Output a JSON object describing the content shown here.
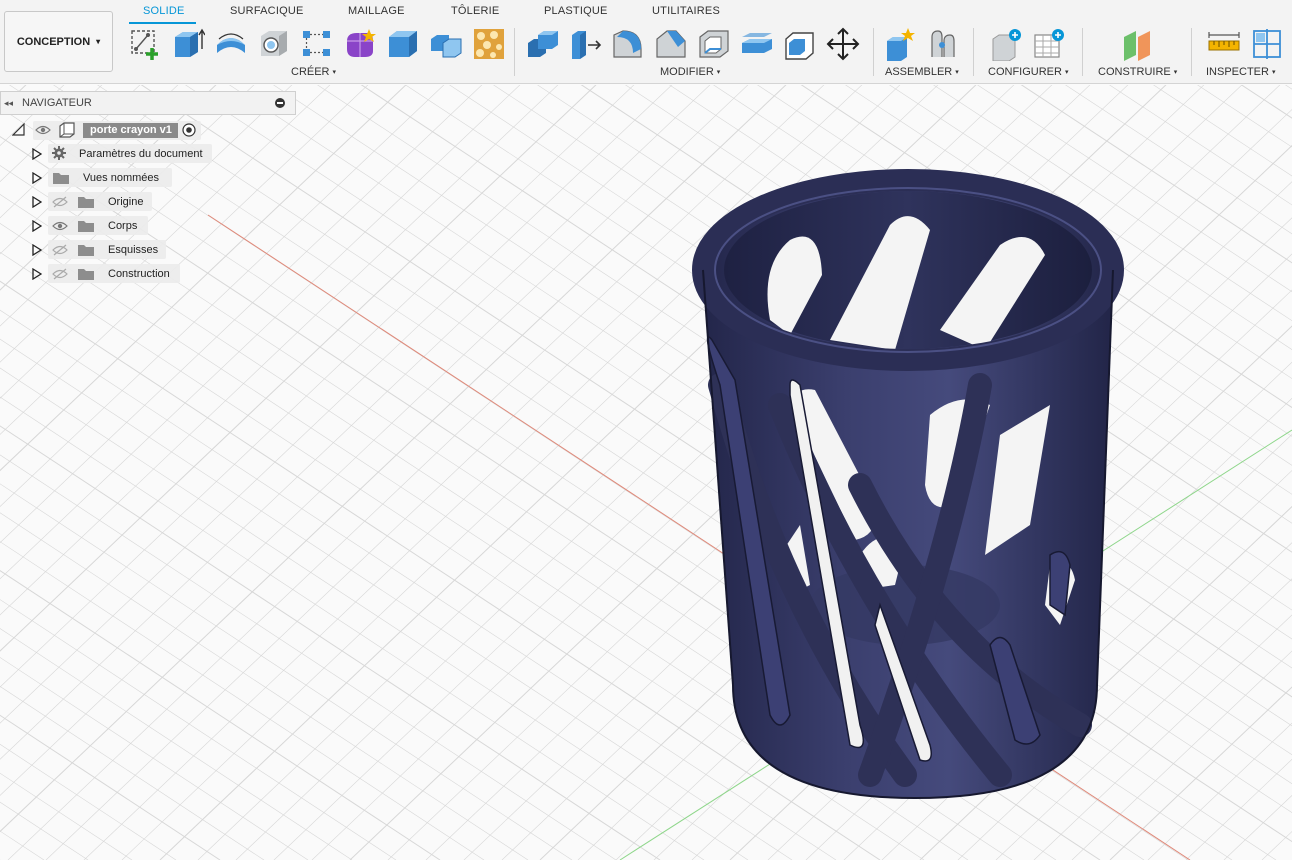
{
  "workspace": {
    "label": "CONCEPTION",
    "caret": "▾"
  },
  "tabs": [
    {
      "label": "SOLIDE",
      "active": true
    },
    {
      "label": "SURFACIQUE"
    },
    {
      "label": "MAILLAGE"
    },
    {
      "label": "TÔLERIE"
    },
    {
      "label": "PLASTIQUE"
    },
    {
      "label": "UTILITAIRES"
    }
  ],
  "groups": {
    "create": {
      "label": "CRÉER",
      "caret": "▾"
    },
    "modify": {
      "label": "MODIFIER",
      "caret": "▾"
    },
    "assemble": {
      "label": "ASSEMBLER",
      "caret": "▾"
    },
    "configure": {
      "label": "CONFIGURER",
      "caret": "▾"
    },
    "construct": {
      "label": "CONSTRUIRE",
      "caret": "▾"
    },
    "inspect": {
      "label": "INSPECTER",
      "caret": "▾"
    }
  },
  "tools": {
    "create": [
      "create-sketch-icon",
      "extrude-icon",
      "revolve-icon",
      "hole-icon",
      "pattern-icon",
      "form-icon",
      "box-icon",
      "combine-icon",
      "lattice-icon"
    ],
    "modify": [
      "press-pull-icon",
      "move-face-icon",
      "fillet-icon",
      "chamfer-icon",
      "shell-icon",
      "draft-icon",
      "scale-icon",
      "move-copy-icon"
    ],
    "assemble": [
      "new-component-icon",
      "joint-icon"
    ],
    "configure": [
      "configure-icon",
      "table-icon"
    ],
    "construct": [
      "offset-plane-icon"
    ],
    "inspect": [
      "measure-icon",
      "section-analysis-icon"
    ]
  },
  "navigator": {
    "title": "NAVIGATEUR",
    "collapse": "◂◂",
    "root": {
      "label": "porte crayon v1"
    },
    "items": [
      {
        "label": "Paramètres du document",
        "icon": "gear-icon"
      },
      {
        "label": "Vues nommées",
        "icon": "folder-icon"
      },
      {
        "label": "Origine",
        "icon": "folder-icon",
        "visible": false
      },
      {
        "label": "Corps",
        "icon": "folder-icon",
        "visible": true
      },
      {
        "label": "Esquisses",
        "icon": "folder-icon",
        "visible": false
      },
      {
        "label": "Construction",
        "icon": "folder-icon",
        "visible": false
      }
    ]
  },
  "colors": {
    "accent": "#0696d7",
    "body": "#2e3157",
    "grid": "#d7d7d7",
    "axis_x": "#e08878",
    "axis_z": "#8ed68a"
  }
}
